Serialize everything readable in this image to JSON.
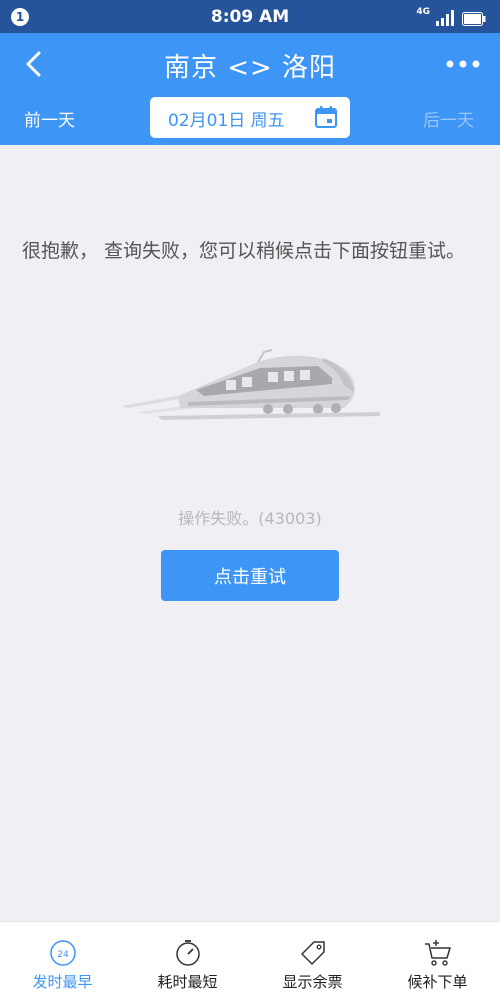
{
  "status_bar": {
    "notification_count": "1",
    "time": "8:09 AM",
    "network": "4G"
  },
  "nav": {
    "title": "南京 <> 洛阳"
  },
  "date_bar": {
    "prev_label": "前一天",
    "date": "02月01日 周五",
    "next_label": "后一天"
  },
  "error_message": "很抱歉， 查询失败，您可以稍候点击下面按钮重试。",
  "fail_code": "操作失败。(43003)",
  "retry_label": "点击重试",
  "tabs": [
    {
      "label": "发时最早",
      "icon": "clock-24-icon",
      "active": true
    },
    {
      "label": "耗时最短",
      "icon": "stopwatch-icon",
      "active": false
    },
    {
      "label": "显示余票",
      "icon": "ticket-tag-icon",
      "active": false
    },
    {
      "label": "候补下单",
      "icon": "cart-add-icon",
      "active": false
    }
  ],
  "colors": {
    "status_bar": "#25549b",
    "primary": "#3d95f5",
    "background": "#efeff4",
    "muted_text": "#b8b8bc"
  }
}
